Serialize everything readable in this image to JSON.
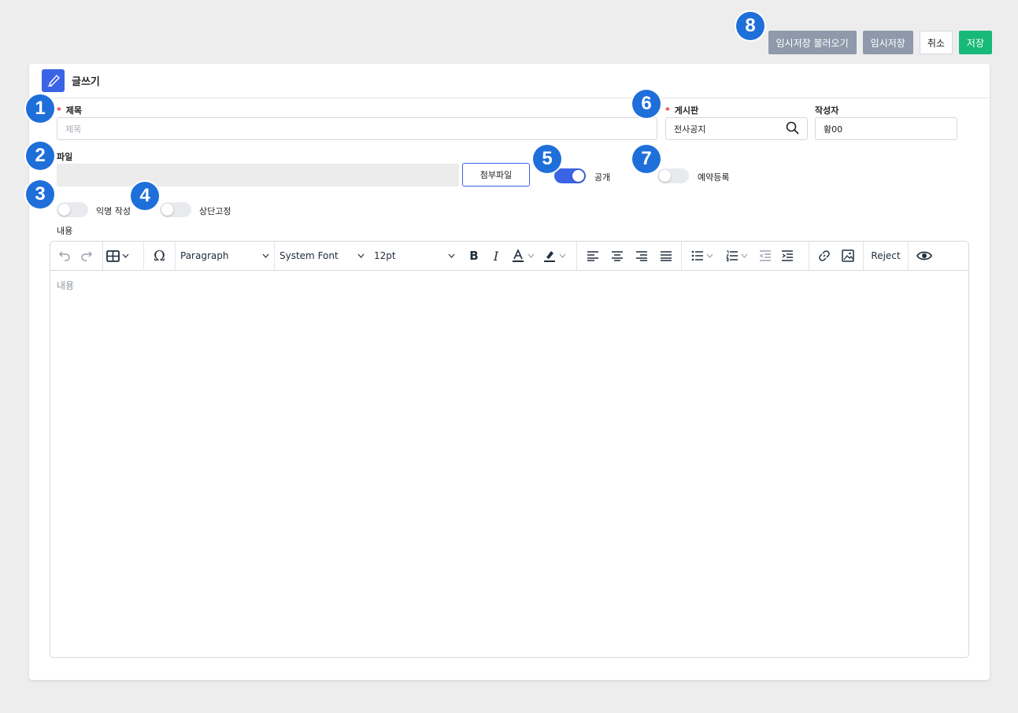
{
  "top_actions": {
    "load_draft": "임시저장 불러오기",
    "save_draft": "임시저장",
    "cancel": "취소",
    "save": "저장"
  },
  "header": {
    "title": "글쓰기",
    "icon": "pen-icon",
    "accent": "#3b63e5"
  },
  "form": {
    "title_label": "제목",
    "title_placeholder": "제목",
    "board_label": "게시판",
    "board_value": "전사공지",
    "author_label": "작성자",
    "author_value": "황00",
    "file_label": "파일",
    "attach_button": "첨부파일",
    "public_label": "공개",
    "public_on": true,
    "reserve_label": "예약등록",
    "reserve_on": false,
    "anonymous_label": "익명 작성",
    "anonymous_on": false,
    "pin_label": "상단고정",
    "pin_on": false,
    "content_label": "내용",
    "content_placeholder": "내용",
    "required_mark": "*"
  },
  "editor_toolbar": {
    "block_format": "Paragraph",
    "font_family": "System Font",
    "font_size": "12pt",
    "reject_label": "Reject"
  },
  "markers": [
    "1",
    "2",
    "3",
    "4",
    "5",
    "6",
    "7",
    "8"
  ],
  "colors": {
    "marker": "#1e6fd9",
    "save": "#17b978",
    "draft": "#8e9aab",
    "required": "#e0262a"
  }
}
